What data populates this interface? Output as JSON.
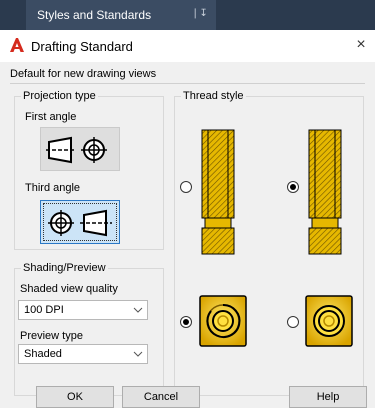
{
  "ribbon": {
    "panel_title": "Styles and Standards",
    "pin_icon": "pin-icon"
  },
  "dialog": {
    "title": "Drafting Standard",
    "app_icon": "autocad-logo-icon",
    "close_glyph": "×",
    "subtitle": "Default for new drawing views",
    "projection": {
      "group_label": "Projection type",
      "first_angle_label": "First angle",
      "third_angle_label": "Third angle",
      "selected": "Third angle"
    },
    "shading": {
      "group_label": "Shading/Preview",
      "quality_label": "Shaded view quality",
      "quality_value": "100 DPI",
      "preview_label": "Preview type",
      "preview_value": "Shaded"
    },
    "thread": {
      "group_label": "Thread style",
      "options": [
        {
          "name": "thread-side-option-1",
          "selected": false
        },
        {
          "name": "thread-side-option-2",
          "selected": true
        },
        {
          "name": "thread-end-option-1",
          "selected": true
        },
        {
          "name": "thread-end-option-2",
          "selected": false
        }
      ]
    },
    "buttons": {
      "ok": "OK",
      "cancel": "Cancel",
      "help": "Help"
    },
    "colors": {
      "accent": "#2b78c5",
      "thread_fill": "#e6b800",
      "ribbon_bg": "#2b3a4e",
      "logo_red": "#d52b1e"
    }
  }
}
